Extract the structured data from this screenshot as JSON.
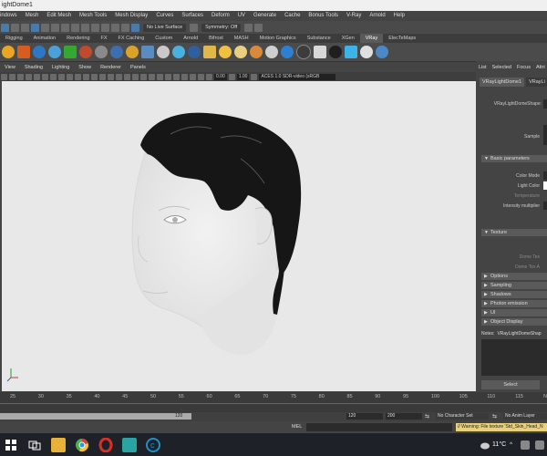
{
  "window": {
    "title": "ightDome1"
  },
  "menubar": [
    "indows",
    "Mesh",
    "Edit Mesh",
    "Mesh Tools",
    "Mesh Display",
    "Curves",
    "Surfaces",
    "Deform",
    "UV",
    "Generate",
    "Cache",
    "Bonus Tools",
    "V-Ray",
    "Arnold",
    "Help"
  ],
  "toolbar": {
    "live_surface": "No Live Surface",
    "symmetry": "Symmetry: Off"
  },
  "shelf_tabs": [
    {
      "label": "Rigging",
      "active": false
    },
    {
      "label": "Animation",
      "active": false
    },
    {
      "label": "Rendering",
      "active": false
    },
    {
      "label": "FX",
      "active": false
    },
    {
      "label": "FX Caching",
      "active": false
    },
    {
      "label": "Custom",
      "active": false
    },
    {
      "label": "Arnold",
      "active": false
    },
    {
      "label": "Bifrost",
      "active": false
    },
    {
      "label": "MASH",
      "active": false
    },
    {
      "label": "Motion Graphics",
      "active": false
    },
    {
      "label": "Substance",
      "active": false
    },
    {
      "label": "XGen",
      "active": false
    },
    {
      "label": "VRay",
      "active": true
    },
    {
      "label": "ElecTeMaps",
      "active": false
    }
  ],
  "viewport_menu": [
    "View",
    "Shading",
    "Lighting",
    "Show",
    "Renderer",
    "Panels"
  ],
  "viewport_toolbar": {
    "value1": "0.00",
    "value2": "1.00",
    "colorspace": "ACES 1.0 SDR-video (sRGB"
  },
  "attribute_editor": {
    "tabs": [
      "List",
      "Selected",
      "Focus",
      "Attri"
    ],
    "node_tab": "VRayLightDome1",
    "node_tab2": "VRayLi",
    "shape_label": "VRayLightDomeShape:",
    "sample_label": "Sample",
    "sections": [
      {
        "label": "Basic parameters",
        "open": true
      },
      {
        "label": "Texture",
        "open": true
      },
      {
        "label": "Options",
        "open": false
      },
      {
        "label": "Sampling",
        "open": false
      },
      {
        "label": "Shadows",
        "open": false
      },
      {
        "label": "Photon emission",
        "open": false
      },
      {
        "label": "UI",
        "open": false
      },
      {
        "label": "Object Display",
        "open": false
      }
    ],
    "basic_fields": [
      {
        "label": "Color Mode",
        "dim": false
      },
      {
        "label": "Light Color",
        "dim": false
      },
      {
        "label": "Temperature",
        "dim": true
      },
      {
        "label": "Intensity multiplier",
        "dim": false
      }
    ],
    "texture_fields": [
      {
        "label": "Dome Tex",
        "dim": true
      },
      {
        "label": "Dome Tex A",
        "dim": true
      }
    ],
    "notes_label": "Notes:",
    "notes_value": "VRayLightDomeShap",
    "select_button": "Select"
  },
  "timeline": {
    "ticks": [
      "25",
      "30",
      "35",
      "40",
      "45",
      "50",
      "55",
      "60",
      "65",
      "70",
      "75",
      "80",
      "85",
      "90",
      "95",
      "100",
      "105",
      "110",
      "115",
      "N"
    ]
  },
  "range": {
    "current": "120",
    "start": "120",
    "end": "200",
    "character_set": "No Character Set",
    "anim_layer": "No Anim Layer"
  },
  "command": {
    "mode": "MEL",
    "warning": "// Warning: File texture 'Std_Skin_Head_N"
  },
  "taskbar": {
    "weather": "11°C",
    "colors": {
      "red": "#d93025",
      "teal": "#2aa3a3",
      "blue": "#1e90c8"
    }
  }
}
